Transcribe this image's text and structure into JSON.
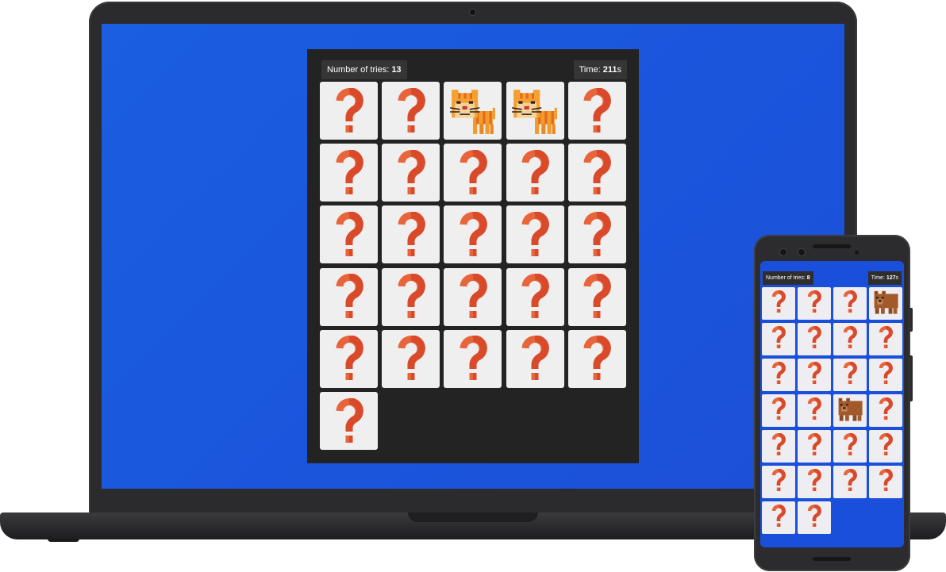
{
  "laptop": {
    "tries_label": "Number of tries: ",
    "tries_value": "13",
    "time_label": "Time: ",
    "time_value": "211",
    "time_unit": "s",
    "cards": [
      "question",
      "question",
      "tiger",
      "tiger",
      "question",
      "question",
      "question",
      "question",
      "question",
      "question",
      "question",
      "question",
      "question",
      "question",
      "question",
      "question",
      "question",
      "question",
      "question",
      "question",
      "question",
      "question",
      "question",
      "question",
      "question",
      "question"
    ]
  },
  "phone": {
    "tries_label": "Number of tries: ",
    "tries_value": "8",
    "time_label": "Time: ",
    "time_value": "127",
    "time_unit": "s",
    "cards": [
      "question",
      "question",
      "question",
      "bear",
      "question",
      "question",
      "question",
      "question",
      "question",
      "question",
      "question",
      "question",
      "question",
      "question",
      "bear",
      "question",
      "question",
      "question",
      "question",
      "question",
      "question",
      "question",
      "question",
      "question",
      "question",
      "question"
    ]
  },
  "icons": {
    "question": "question-mark-icon",
    "tiger": "tiger-icon",
    "bear": "bear-icon"
  },
  "colors": {
    "screen_blue": "#1b5ee0",
    "board_bg": "#232323",
    "card_bg": "#efefef",
    "question_orange": "#e8643a"
  }
}
